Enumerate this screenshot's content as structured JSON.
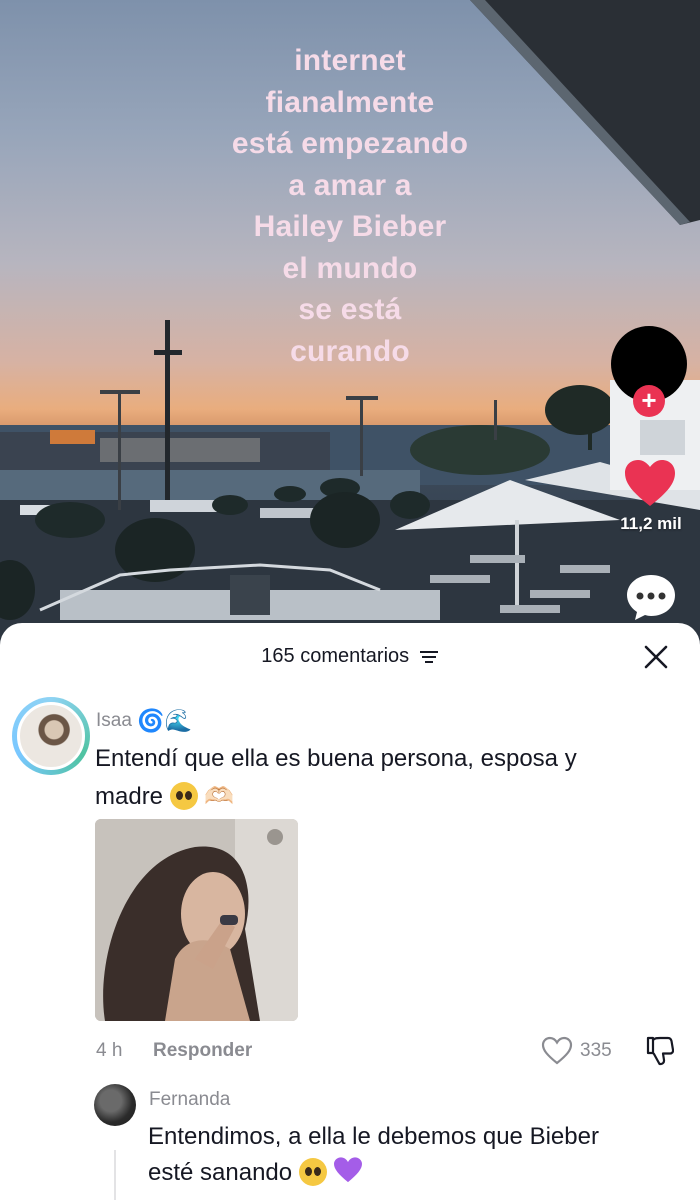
{
  "video": {
    "overlay_lines": [
      "internet",
      "fianalmente",
      "está empezando",
      "a amar a",
      "Hailey Bieber",
      "el mundo",
      "se está",
      "curando"
    ],
    "like_count": "11,2 mil",
    "follow_icon": "plus-icon",
    "colors": {
      "overlay_text": "#f6dbe8",
      "like_red": "#ea3353"
    }
  },
  "comments_panel": {
    "count_label": "165 comentarios",
    "sort_icon": "sort-icon",
    "close_icon": "close-icon"
  },
  "comments": [
    {
      "username": "Isaa",
      "username_emojis": "🌀🌊",
      "text_line1": "Entendí que ella es buena persona, esposa y",
      "text_line2": "madre",
      "text_emojis": "🫶🏻",
      "has_photo": true,
      "time": "4 h",
      "reply_label": "Responder",
      "likes": "335"
    },
    {
      "username": "Fernanda",
      "text_line1": "Entendimos, a ella le debemos que Bieber",
      "text_line2": "esté sanando"
    }
  ]
}
